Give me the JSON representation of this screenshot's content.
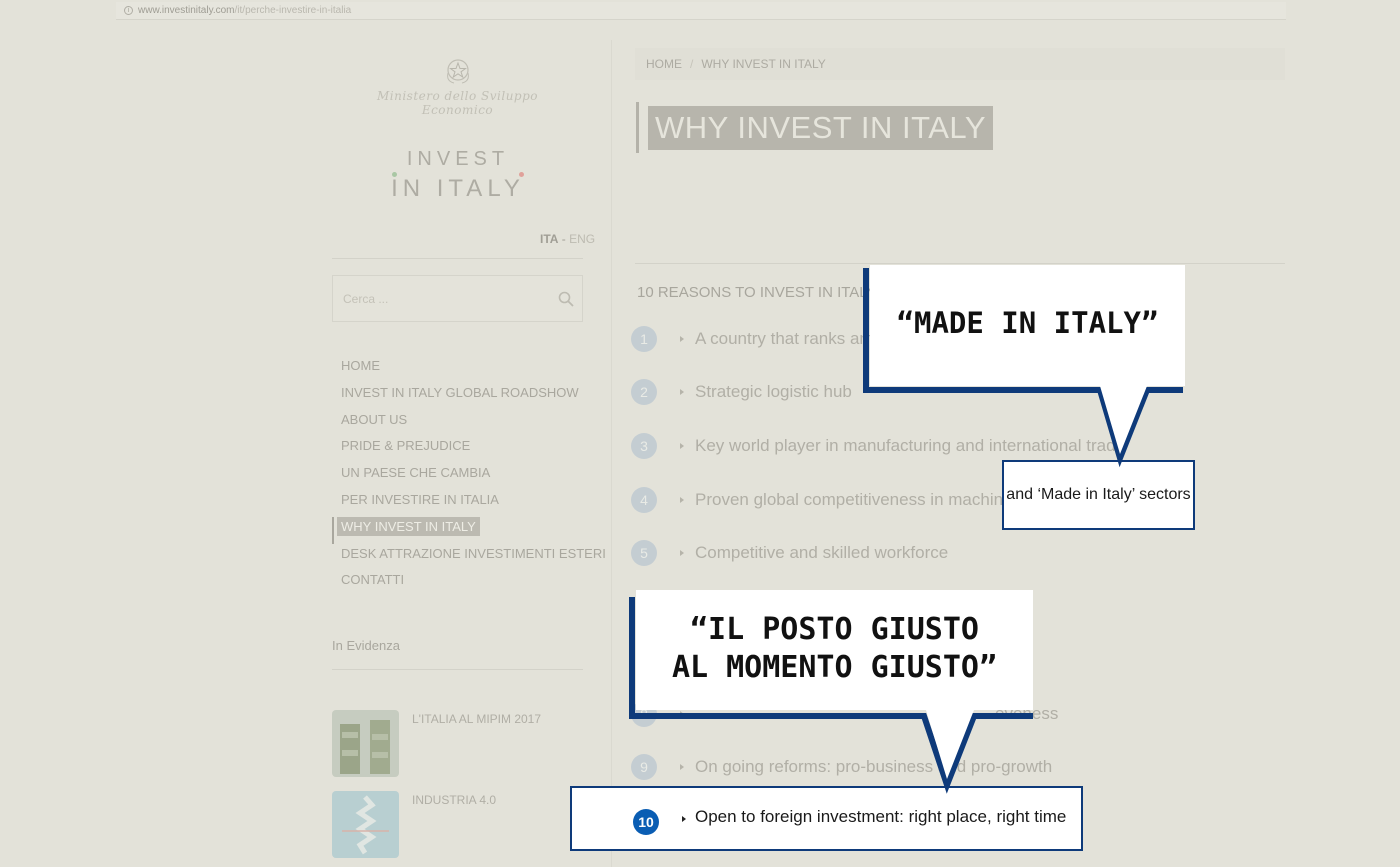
{
  "browser": {
    "url_domain": "www.investinitaly.com",
    "url_path": "/it/perche-investire-in-italia"
  },
  "sidebar": {
    "ministry_name": "Ministero dello Sviluppo Economico",
    "logo_line1": "INVEST",
    "logo_line2": "IN ITALY",
    "lang_ita": "ITA",
    "lang_sep": " - ",
    "lang_eng": "ENG",
    "search_placeholder": "Cerca ...",
    "nav": [
      "HOME",
      "INVEST IN ITALY GLOBAL ROADSHOW",
      "ABOUT US",
      "PRIDE & PREJUDICE",
      "UN PAESE CHE CAMBIA",
      "PER INVESTIRE IN ITALIA",
      "WHY INVEST IN ITALY",
      "DESK ATTRAZIONE INVESTIMENTI ESTERI",
      "CONTATTI"
    ],
    "evidenza_title": "In Evidenza",
    "evidenza_items": [
      "L'ITALIA AL MIPIM 2017",
      "INDUSTRIA 4.0"
    ]
  },
  "main": {
    "breadcrumb": [
      "HOME",
      "/",
      "WHY INVEST IN ITALY"
    ],
    "title": "WHY INVEST IN ITALY",
    "reasons_heading": "10 REASONS TO INVEST IN ITALY",
    "reasons": [
      {
        "num": "1",
        "text": "A country that ranks amo"
      },
      {
        "num": "2",
        "text": "Strategic logistic hub"
      },
      {
        "num": "3",
        "text": "Key world player in manufacturing and international trade"
      },
      {
        "num": "4",
        "text": "Proven global competitiveness in machinery"
      },
      {
        "num": "5",
        "text": "Competitive and skilled workforce"
      },
      {
        "num": "8",
        "text": "eveness"
      },
      {
        "num": "9",
        "text": "On going reforms: pro-business and pro-growth"
      },
      {
        "num": "10",
        "text": "Open to foreign investment: right place, right time"
      }
    ],
    "highlight_made_text": "and ‘Made in Italy’ sectors"
  },
  "callouts": {
    "made_in_italy": "“MADE IN ITALY”",
    "posto_line1": "“IL POSTO GIUSTO",
    "posto_line2": "AL MOMENTO GIUSTO”"
  },
  "colors": {
    "background": "#e3e2d9",
    "callout_border": "#0e3a7a",
    "highlight_number": "#0a5db3"
  }
}
